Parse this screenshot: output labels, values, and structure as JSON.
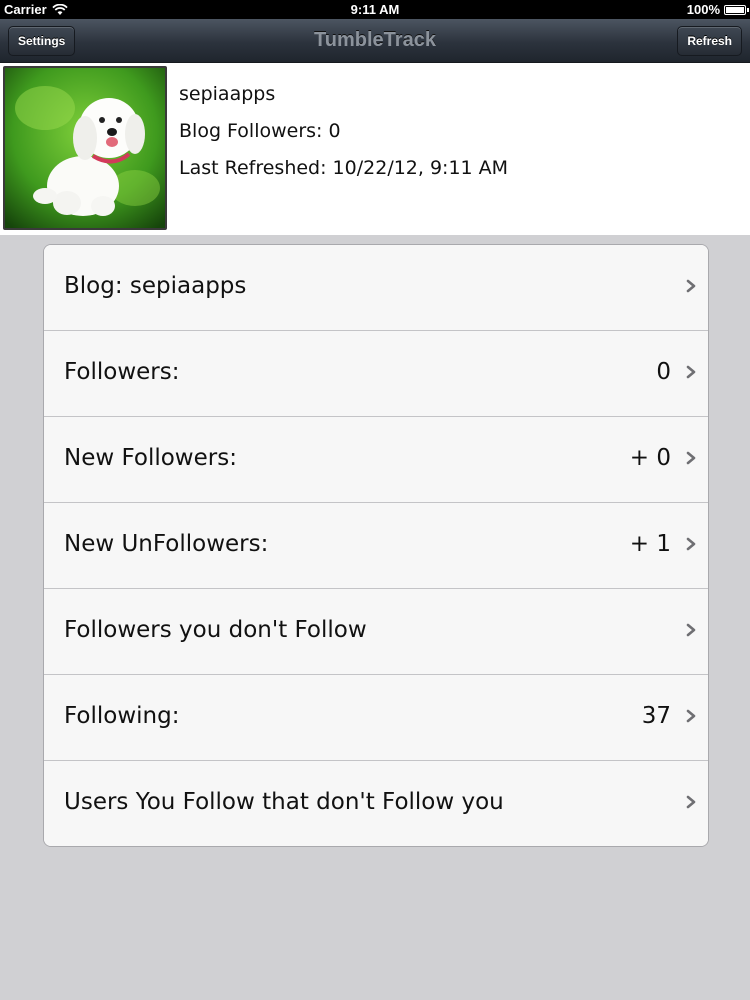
{
  "status_bar": {
    "carrier": "Carrier",
    "time": "9:11 AM",
    "battery": "100%",
    "wifi_icon": "wifi-icon",
    "battery_icon": "battery-icon"
  },
  "nav": {
    "title": "TumbleTrack",
    "left_button": "Settings",
    "right_button": "Refresh"
  },
  "profile": {
    "avatar_icon": "dog-avatar",
    "username": "sepiaapps",
    "blog_followers": "Blog Followers: 0",
    "last_refreshed": "Last Refreshed: 10/22/12, 9:11 AM"
  },
  "rows": [
    {
      "label": "Blog:  sepiaapps",
      "value": ""
    },
    {
      "label": "Followers:",
      "value": "0"
    },
    {
      "label": "New Followers:",
      "value": "+ 0"
    },
    {
      "label": "New UnFollowers:",
      "value": "+ 1"
    },
    {
      "label": "Followers you don't Follow",
      "value": ""
    },
    {
      "label": "Following:",
      "value": "37"
    },
    {
      "label": "Users You Follow that don't Follow you",
      "value": ""
    }
  ],
  "colors": {
    "background": "#d0d0d3",
    "navbar": "#2c333d",
    "cell": "#f7f7f7"
  }
}
